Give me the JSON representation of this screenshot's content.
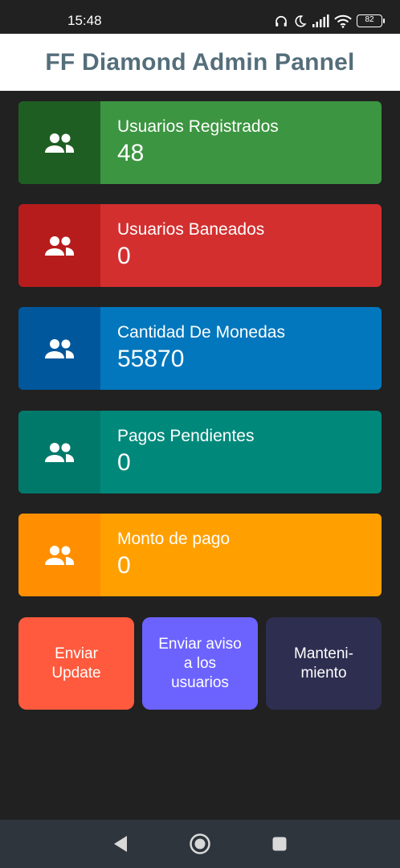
{
  "status_bar": {
    "time": "15:48",
    "battery": "82"
  },
  "header": {
    "title": "FF Diamond Admin Pannel",
    "title_color": "#546E7A"
  },
  "stats": [
    {
      "label": "Usuarios Registrados",
      "value": "48",
      "color": "#3C9541",
      "icon_bg": "#1E5E22",
      "icon": "users-icon"
    },
    {
      "label": "Usuarios Baneados",
      "value": "0",
      "color": "#D32F2F",
      "icon_bg": "#B71C1C",
      "icon": "users-icon"
    },
    {
      "label": "Cantidad De Monedas",
      "value": "55870",
      "color": "#0277BD",
      "icon_bg": "#01579B",
      "icon": "users-icon"
    },
    {
      "label": "Pagos Pendientes",
      "value": "0",
      "color": "#00897B",
      "icon_bg": "#00796B",
      "icon": "users-icon"
    },
    {
      "label": "Monto de pago",
      "value": "0",
      "color": "#FFA000",
      "icon_bg": "#FF8F00",
      "icon": "users-icon"
    }
  ],
  "actions": [
    {
      "label": "Enviar Update",
      "color": "#FF5A3D"
    },
    {
      "label": "Enviar aviso a los usuarios",
      "color": "#6C63FF"
    },
    {
      "label": "Manteni-miento",
      "color": "#2D2E50"
    }
  ],
  "nav": {
    "back_icon": "back-triangle-icon",
    "home_icon": "home-circle-icon",
    "recents_icon": "recents-square-icon"
  }
}
